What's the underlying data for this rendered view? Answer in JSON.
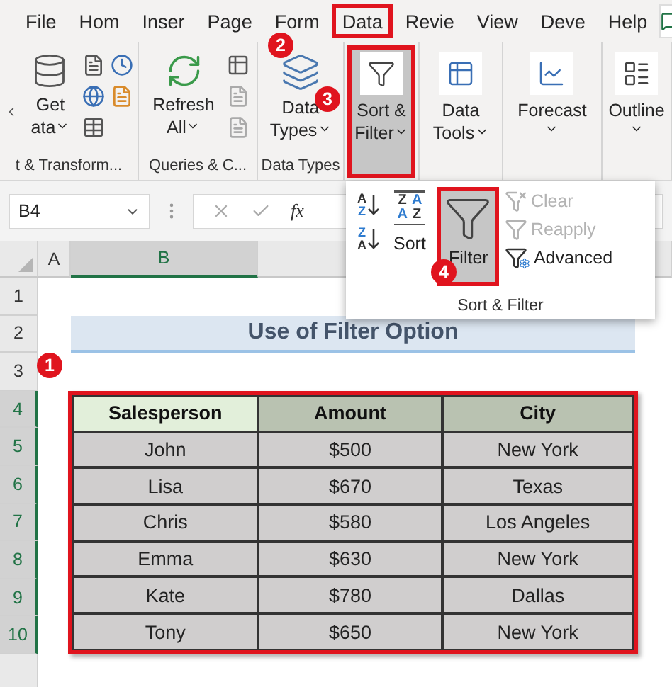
{
  "menu_tabs": [
    {
      "label": "File",
      "highlighted": false
    },
    {
      "label": "Hom",
      "highlighted": false
    },
    {
      "label": "Inser",
      "highlighted": false
    },
    {
      "label": "Page",
      "highlighted": false
    },
    {
      "label": "Form",
      "highlighted": false
    },
    {
      "label": "Data",
      "highlighted": true
    },
    {
      "label": "Revie",
      "highlighted": false
    },
    {
      "label": "View",
      "highlighted": false
    },
    {
      "label": "Deve",
      "highlighted": false
    },
    {
      "label": "Help",
      "highlighted": false
    }
  ],
  "ribbon_groups": [
    {
      "label": "t & Transform...",
      "button": {
        "lines": [
          "Get",
          "ata"
        ],
        "dropdown": true,
        "pressed": false,
        "highlighted": false
      }
    },
    {
      "label": "Queries & C...",
      "button": {
        "lines": [
          "Refresh",
          "All"
        ],
        "dropdown": true,
        "pressed": false,
        "highlighted": false
      }
    },
    {
      "label": "Data Types",
      "button": {
        "lines": [
          "Data",
          "Types"
        ],
        "dropdown": true,
        "pressed": false,
        "highlighted": false
      }
    },
    {
      "button": {
        "lines": [
          "Sort &",
          "Filter"
        ],
        "dropdown": true,
        "pressed": true,
        "highlighted": true
      }
    },
    {
      "button": {
        "lines": [
          "Data",
          "Tools"
        ],
        "dropdown": true,
        "pressed": false,
        "highlighted": false
      }
    },
    {
      "button": {
        "lines": [
          "Forecast"
        ],
        "dropdown": true,
        "pressed": false,
        "highlighted": false
      }
    },
    {
      "button": {
        "lines": [
          "Outline"
        ],
        "dropdown": true,
        "pressed": false,
        "highlighted": false
      }
    }
  ],
  "formula_bar": {
    "name_box": "B4",
    "function_label": "fx"
  },
  "sort_filter_menu": {
    "title": "Sort & Filter",
    "quick_sorts": [
      {
        "letters": [
          "A",
          "Z"
        ]
      },
      {
        "letters": [
          "Z",
          "A"
        ]
      }
    ],
    "sort_icon_letters": [
      "Z",
      "A",
      "A",
      "Z"
    ],
    "sort_label": "Sort",
    "filter": {
      "label": "Filter",
      "pressed": true,
      "highlighted": true
    },
    "commands": [
      {
        "label": "Clear",
        "disabled": true
      },
      {
        "label": "Reapply",
        "disabled": true
      },
      {
        "label": "Advanced",
        "disabled": false
      }
    ]
  },
  "sheet": {
    "columns": [
      {
        "label": "A",
        "selected": false
      },
      {
        "label": "B",
        "selected": true
      }
    ],
    "rows": [
      {
        "label": "1",
        "selected": false
      },
      {
        "label": "2",
        "selected": false
      },
      {
        "label": "3",
        "selected": false
      },
      {
        "label": "4",
        "selected": true
      },
      {
        "label": "5",
        "selected": true
      },
      {
        "label": "6",
        "selected": true
      },
      {
        "label": "7",
        "selected": true
      },
      {
        "label": "8",
        "selected": true
      },
      {
        "label": "9",
        "selected": true
      },
      {
        "label": "10",
        "selected": true
      }
    ],
    "title": "Use of Filter Option",
    "table": {
      "highlighted": true,
      "columns": [
        {
          "label": "Salesperson",
          "selected": true
        },
        {
          "label": "Amount",
          "selected": false
        },
        {
          "label": "City",
          "selected": false
        }
      ],
      "rows": [
        [
          "John",
          "$500",
          "New York"
        ],
        [
          "Lisa",
          "$670",
          "Texas"
        ],
        [
          "Chris",
          "$580",
          "Los Angeles"
        ],
        [
          "Emma",
          "$630",
          "New York"
        ],
        [
          "Kate",
          "$780",
          "Dallas"
        ],
        [
          "Tony",
          "$650",
          "New York"
        ]
      ]
    }
  },
  "step_markers": [
    {
      "label": "2"
    },
    {
      "label": "3"
    },
    {
      "label": "4"
    },
    {
      "label": "1"
    }
  ]
}
